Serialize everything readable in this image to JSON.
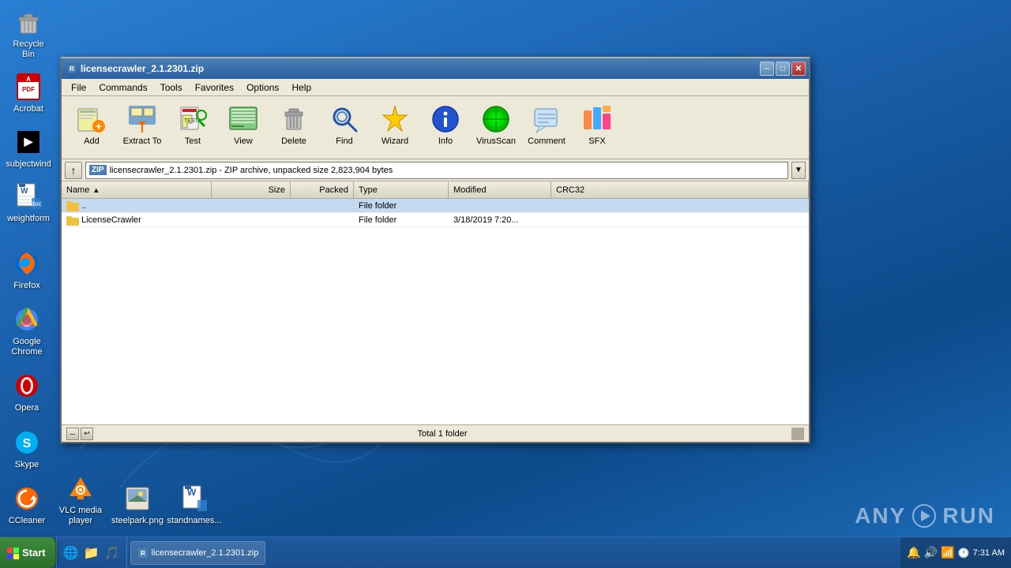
{
  "desktop": {
    "background": "windows7-blue"
  },
  "desktop_icons_top": [
    {
      "id": "recycle-bin",
      "label": "Recycle Bin",
      "icon": "🗑️"
    },
    {
      "id": "acrobat",
      "label": "Acrobat",
      "icon": "📄"
    },
    {
      "id": "subjectwind",
      "label": "subjectwind",
      "icon": "■"
    },
    {
      "id": "weightform",
      "label": "weightform",
      "icon": "📝"
    }
  ],
  "desktop_icons_bottom": [
    {
      "id": "firefox",
      "label": "Firefox",
      "icon": "🦊"
    },
    {
      "id": "chrome",
      "label": "Google Chrome",
      "icon": "🔵"
    },
    {
      "id": "opera",
      "label": "Opera",
      "icon": "O"
    },
    {
      "id": "skype",
      "label": "Skype",
      "icon": "S"
    },
    {
      "id": "ccleaner",
      "label": "CCleaner",
      "icon": "⟳"
    },
    {
      "id": "vlc",
      "label": "VLC media player",
      "icon": "🔶"
    },
    {
      "id": "steelpark",
      "label": "steelpark.png",
      "icon": "🖼️"
    },
    {
      "id": "standnames",
      "label": "standnames...",
      "icon": "📝"
    }
  ],
  "window": {
    "title": "licensecrawler_2.1.2301.zip",
    "titlebar_icon": "📦"
  },
  "menu": {
    "items": [
      "File",
      "Commands",
      "Tools",
      "Favorites",
      "Options",
      "Help"
    ]
  },
  "toolbar": {
    "buttons": [
      {
        "id": "add",
        "label": "Add",
        "icon": "add"
      },
      {
        "id": "extract-to",
        "label": "Extract To",
        "icon": "extract"
      },
      {
        "id": "test",
        "label": "Test",
        "icon": "test"
      },
      {
        "id": "view",
        "label": "View",
        "icon": "view"
      },
      {
        "id": "delete",
        "label": "Delete",
        "icon": "delete"
      },
      {
        "id": "find",
        "label": "Find",
        "icon": "find"
      },
      {
        "id": "wizard",
        "label": "Wizard",
        "icon": "wizard"
      },
      {
        "id": "info",
        "label": "Info",
        "icon": "info"
      },
      {
        "id": "virusscan",
        "label": "VirusScan",
        "icon": "virusscan"
      },
      {
        "id": "comment",
        "label": "Comment",
        "icon": "comment"
      },
      {
        "id": "sfx",
        "label": "SFX",
        "icon": "sfx"
      }
    ]
  },
  "address_bar": {
    "path": "licensecrawler_2.1.2301.zip - ZIP archive, unpacked size 2,823,904 bytes"
  },
  "columns": [
    {
      "id": "name",
      "label": "Name",
      "sorted": true,
      "sort_dir": "asc"
    },
    {
      "id": "size",
      "label": "Size"
    },
    {
      "id": "packed",
      "label": "Packed"
    },
    {
      "id": "type",
      "label": "Type"
    },
    {
      "id": "modified",
      "label": "Modified"
    },
    {
      "id": "crc32",
      "label": "CRC32"
    }
  ],
  "files": [
    {
      "name": "..",
      "size": "",
      "packed": "",
      "type": "File folder",
      "modified": "",
      "crc32": "",
      "is_folder": true
    },
    {
      "name": "LicenseCrawler",
      "size": "",
      "packed": "",
      "type": "File folder",
      "modified": "3/18/2019 7:20...",
      "crc32": "",
      "is_folder": true
    }
  ],
  "status": {
    "text": "Total 1 folder"
  },
  "taskbar": {
    "start_label": "Start",
    "quick_launch": [
      "🌐",
      "📁",
      "🔊"
    ],
    "active_window": "licensecrawler_2.1.2301.zip",
    "tray_icons": [
      "🔔",
      "🔊",
      "📶"
    ],
    "time": "7:31 AM"
  },
  "anyrun": {
    "text": "ANY▶RUN"
  }
}
